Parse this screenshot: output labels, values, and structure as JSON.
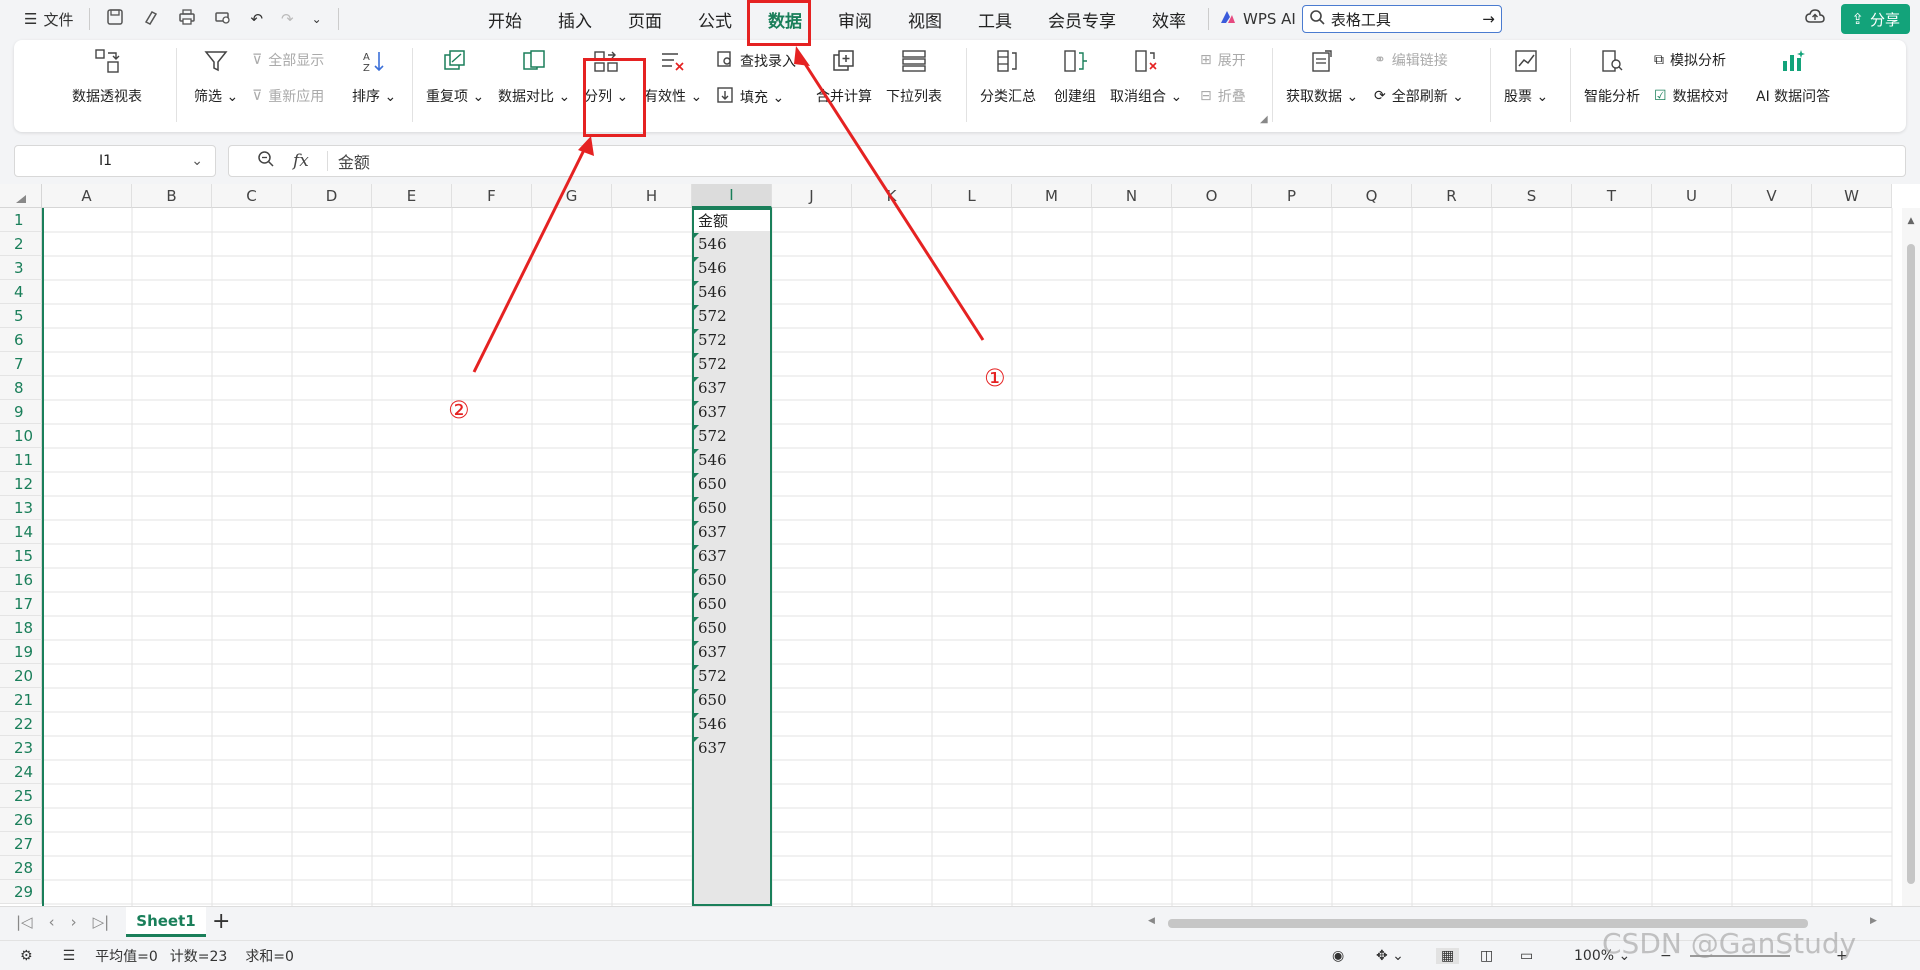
{
  "titlebar": {
    "file_label": "文件",
    "tabs": [
      "开始",
      "插入",
      "页面",
      "公式",
      "数据",
      "审阅",
      "视图",
      "工具",
      "会员专享",
      "效率"
    ],
    "active_tab": "数据",
    "wps_ai": "WPS AI",
    "search_placeholder": "表格工具",
    "share_label": "分享"
  },
  "ribbon": {
    "pivot": "数据透视表",
    "filter": "筛选",
    "show_all": "全部显示",
    "reapply": "重新应用",
    "sort": "排序",
    "duplicates": "重复项",
    "compare": "数据对比",
    "split": "分列",
    "validity": "有效性",
    "lookup": "查找录入",
    "fill": "填充",
    "consolidate": "合并计算",
    "dropdown": "下拉列表",
    "subtotal": "分类汇总",
    "group": "创建组",
    "ungroup": "取消组合",
    "expand": "展开",
    "collapse": "折叠",
    "get_data": "获取数据",
    "edit_links": "编辑链接",
    "refresh_all": "全部刷新",
    "stocks": "股票",
    "smart_analysis": "智能分析",
    "what_if": "模拟分析",
    "data_check": "数据校对",
    "ai_qa": "AI 数据问答"
  },
  "formula": {
    "cell_ref": "I1",
    "fx": "fx",
    "content": "金额"
  },
  "columns": [
    "A",
    "B",
    "C",
    "D",
    "E",
    "F",
    "G",
    "H",
    "I",
    "J",
    "K",
    "L",
    "M",
    "N",
    "O",
    "P",
    "Q",
    "R",
    "S",
    "T",
    "U",
    "V",
    "W"
  ],
  "rows": [
    "1",
    "2",
    "3",
    "4",
    "5",
    "6",
    "7",
    "8",
    "9",
    "10",
    "11",
    "12",
    "13",
    "14",
    "15",
    "16",
    "17",
    "18",
    "19",
    "20",
    "21",
    "22",
    "23",
    "24",
    "25",
    "26",
    "27",
    "28",
    "29"
  ],
  "column_i_values": [
    "金额",
    "546",
    "546",
    "546",
    "572",
    "572",
    "572",
    "637",
    "637",
    "572",
    "546",
    "650",
    "650",
    "637",
    "637",
    "650",
    "650",
    "650",
    "637",
    "572",
    "650",
    "546",
    "637"
  ],
  "sheet": {
    "name": "Sheet1",
    "add": "+"
  },
  "status": {
    "average": "平均值=0",
    "count": "计数=23",
    "sum": "求和=0",
    "zoom": "100%",
    "watermark": "CSDN @GanStudy"
  },
  "annotations": {
    "one": "①",
    "two": "②"
  },
  "colors": {
    "accent": "#1a7f5a",
    "highlight": "#e52222"
  }
}
